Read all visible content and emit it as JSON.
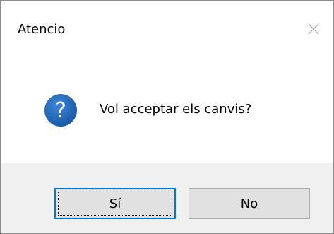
{
  "dialog": {
    "title": "Atencio",
    "close_icon": "close-icon",
    "message": "Vol acceptar els canvis?",
    "icon": "question-icon",
    "colors": {
      "icon_blue": "#1d62b5",
      "footer_bg": "#f0f0f0",
      "focus_border": "#0078d7",
      "button_bg": "#e1e1e1"
    }
  },
  "buttons": {
    "yes_label": "Sí",
    "no_label": "No"
  }
}
